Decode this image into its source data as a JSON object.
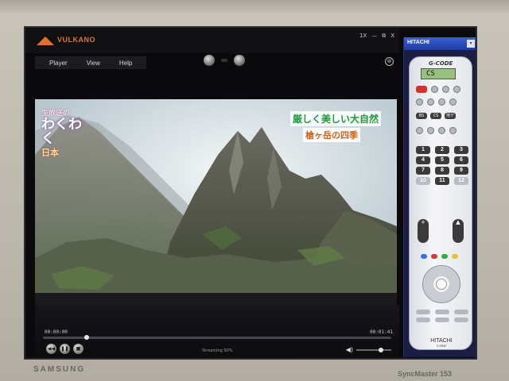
{
  "monitor": {
    "brand": "SAMSUNG",
    "model": "SyncMaster 153"
  },
  "player": {
    "app_name": "VULKANO",
    "window_controls": [
      "1X",
      "—",
      "⧉",
      "X"
    ],
    "menu": [
      "Player",
      "View",
      "Help"
    ],
    "close_symbol": "⊗",
    "time_elapsed": "00:00:00",
    "time_total": "00:01:41",
    "status": "Streaming 90%",
    "seek_progress": 0.13,
    "volume_level": 0.75
  },
  "video": {
    "show_logo": {
      "line1": "生放送の",
      "line2": "わくわく",
      "line3": "日本"
    },
    "caption_line1": "厳しく美しい大自然",
    "caption_line2": "槍ヶ岳の四季"
  },
  "remote": {
    "panel_title": "HITACHI",
    "dropdown_symbol": "▾",
    "gcode_label": "G-CODE",
    "lcd_text": "CS",
    "source_buttons": [
      "BS",
      "CS",
      "地デ"
    ],
    "numbers": [
      "1",
      "2",
      "3",
      "4",
      "5",
      "6",
      "7",
      "8",
      "9",
      "10",
      "11",
      "12"
    ],
    "vol_label": "+",
    "ch_label": "▲",
    "brand": "HITACHI",
    "brand_sub": "C-RN2"
  },
  "colors": {
    "brand_orange": "#d9782f",
    "remote_header": "#1c3da8",
    "lcd_green": "#98c17f",
    "power_red": "#d0342a"
  }
}
